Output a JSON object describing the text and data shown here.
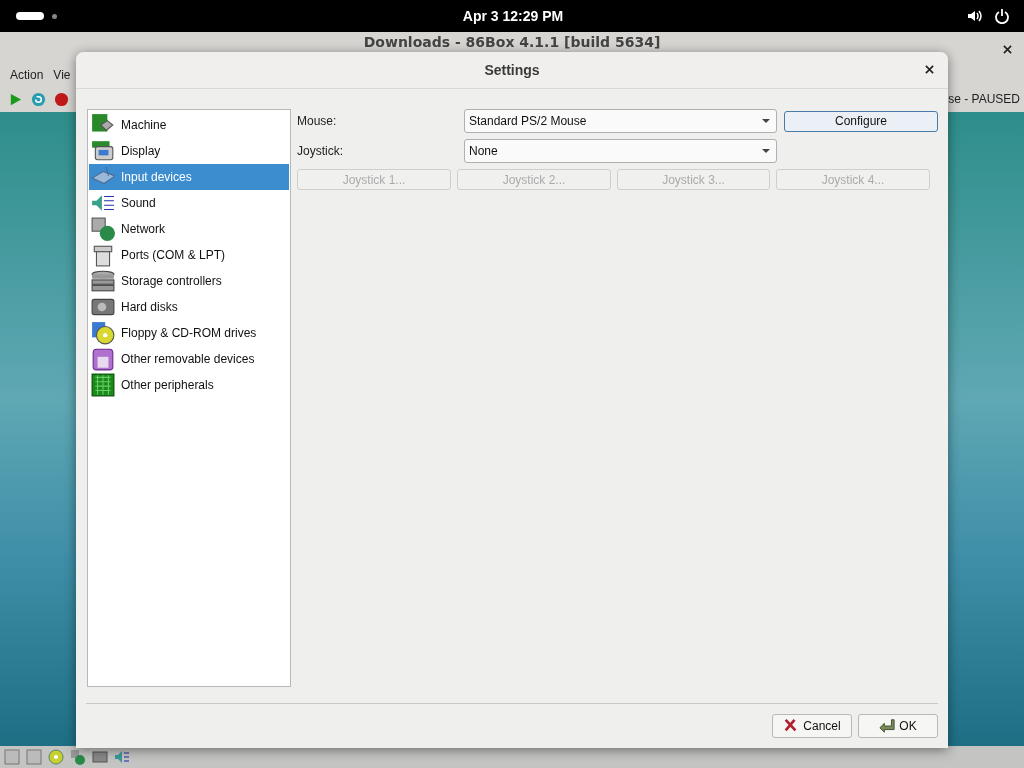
{
  "top_bar": {
    "clock": "Apr 3  12:29 PM"
  },
  "main_window": {
    "title": "Downloads - 86Box 4.1.1 [build 5634]",
    "menu": [
      "Action",
      "Vie"
    ],
    "status_text": "se - PAUSED"
  },
  "dialog": {
    "title": "Settings",
    "sidebar": {
      "items": [
        {
          "label": "Machine",
          "selected": false
        },
        {
          "label": "Display",
          "selected": false
        },
        {
          "label": "Input devices",
          "selected": true
        },
        {
          "label": "Sound",
          "selected": false
        },
        {
          "label": "Network",
          "selected": false
        },
        {
          "label": "Ports (COM & LPT)",
          "selected": false
        },
        {
          "label": "Storage controllers",
          "selected": false
        },
        {
          "label": "Hard disks",
          "selected": false
        },
        {
          "label": "Floppy & CD-ROM drives",
          "selected": false
        },
        {
          "label": "Other removable devices",
          "selected": false
        },
        {
          "label": "Other peripherals",
          "selected": false
        }
      ]
    },
    "mouse": {
      "label": "Mouse:",
      "value": "Standard PS/2 Mouse",
      "configure": {
        "label": "Configure",
        "disabled": false
      }
    },
    "joystick": {
      "label": "Joystick:",
      "value": "None"
    },
    "joystick_buttons": [
      {
        "label": "Joystick 1...",
        "disabled": true
      },
      {
        "label": "Joystick 2...",
        "disabled": true
      },
      {
        "label": "Joystick 3...",
        "disabled": true
      },
      {
        "label": "Joystick 4...",
        "disabled": true
      }
    ],
    "buttons": [
      {
        "kind": "cancel",
        "label": "Cancel"
      },
      {
        "kind": "ok",
        "label": "OK"
      }
    ]
  }
}
